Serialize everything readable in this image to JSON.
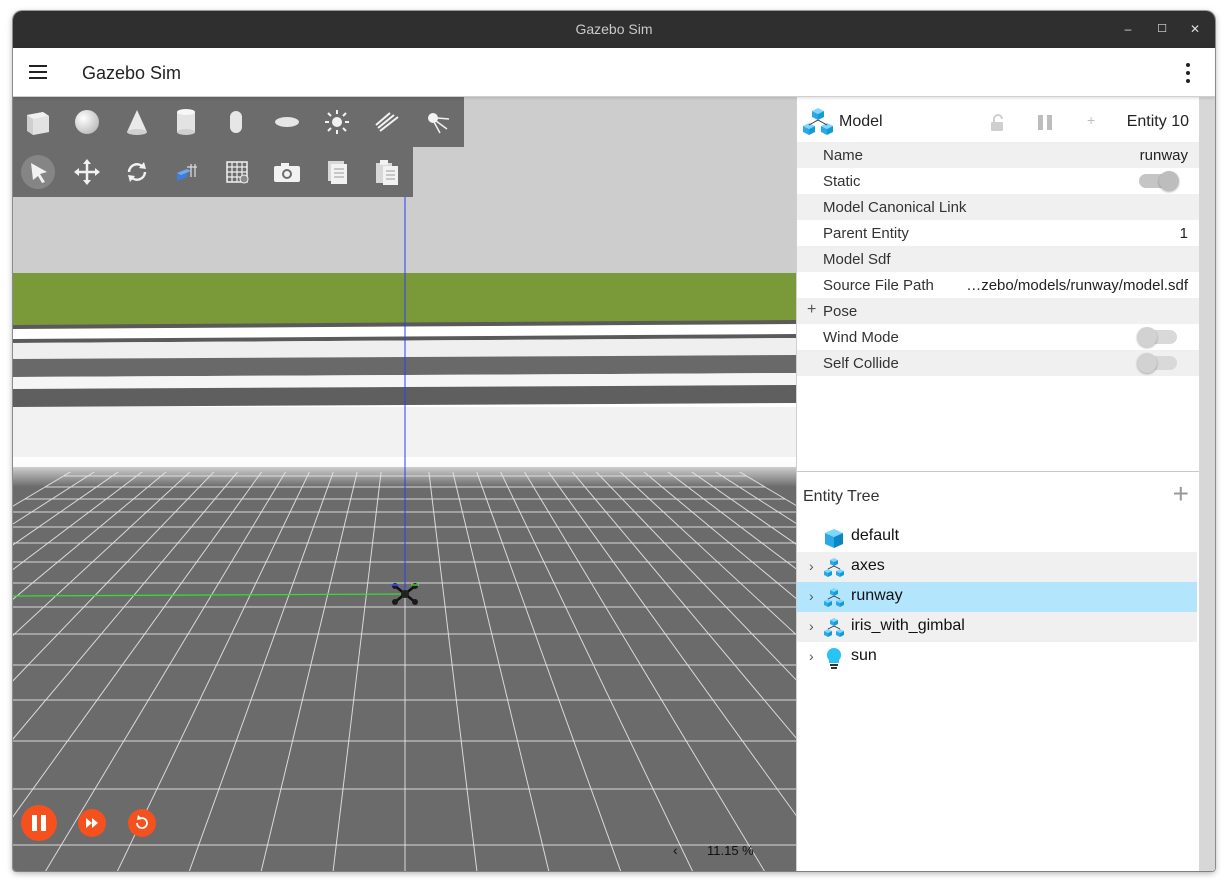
{
  "window": {
    "title": "Gazebo Sim"
  },
  "window_controls": {
    "minimize": "–",
    "maximize": "☐",
    "close": "✕"
  },
  "app_bar": {
    "title": "Gazebo Sim"
  },
  "shapes_toolbar": [
    "box-icon",
    "sphere-icon",
    "cone-icon",
    "cylinder-icon",
    "capsule-icon",
    "ellipsoid-icon",
    "directional-light-icon",
    "spot-light-icon",
    "point-light-icon"
  ],
  "transform_toolbar": [
    "select-arrow-icon",
    "translate-icon",
    "rotate-icon",
    "snap-icon",
    "grid-icon",
    "camera-screenshot-icon",
    "copy-icon",
    "paste-icon"
  ],
  "playback": {
    "rtf_label": "11.15 %",
    "collapse_arrow": "‹"
  },
  "component_inspector": {
    "title": "Model",
    "entity_label": "Entity 10",
    "plus_label": "+",
    "properties": [
      {
        "label": "Name",
        "value": "runway",
        "type": "text"
      },
      {
        "label": "Static",
        "value": "",
        "type": "toggle",
        "state": "on"
      },
      {
        "label": "Model Canonical Link",
        "value": "",
        "type": "text"
      },
      {
        "label": "Parent Entity",
        "value": "1",
        "type": "text"
      },
      {
        "label": "Model Sdf",
        "value": "",
        "type": "text"
      },
      {
        "label": "Source File Path",
        "value": "…zebo/models/runway/model.sdf",
        "type": "text"
      },
      {
        "label": "Pose",
        "value": "",
        "type": "expand"
      },
      {
        "label": "Wind Mode",
        "value": "",
        "type": "toggle",
        "state": "off"
      },
      {
        "label": "Self Collide",
        "value": "",
        "type": "toggle",
        "state": "off"
      }
    ]
  },
  "entity_tree": {
    "title": "Entity Tree",
    "add_label": "+",
    "items": [
      {
        "label": "default",
        "icon": "world-cube-icon",
        "expandable": false
      },
      {
        "label": "axes",
        "icon": "model-icon",
        "expandable": true
      },
      {
        "label": "runway",
        "icon": "model-icon",
        "expandable": true,
        "selected": true
      },
      {
        "label": "iris_with_gimbal",
        "icon": "model-icon",
        "expandable": true
      },
      {
        "label": "sun",
        "icon": "light-bulb-icon",
        "expandable": true
      }
    ]
  },
  "colors": {
    "accent": "#f4511e",
    "selection": "#b3e5fc",
    "toolbar": "#6c6c6c",
    "titlebar": "#2f2f2f"
  }
}
